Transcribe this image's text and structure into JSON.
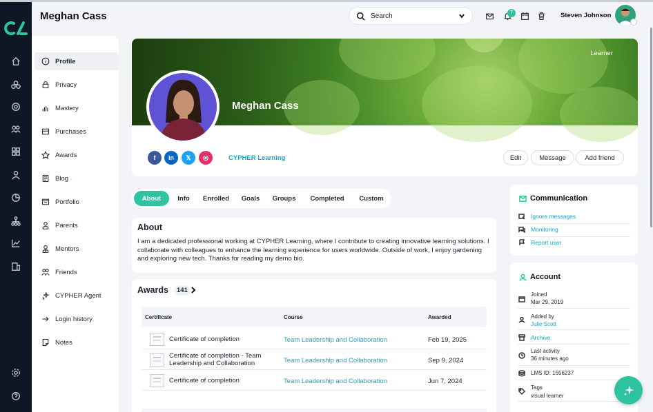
{
  "header": {
    "page_title": "Meghan Cass",
    "search_placeholder": "Search",
    "notification_count": "7",
    "user_name": "Steven Johnson"
  },
  "rail": {
    "icons": [
      "home-icon",
      "catalog-icon",
      "target-icon",
      "group-icon",
      "apps-icon",
      "person-icon",
      "chart-pie-icon",
      "org-chart-icon",
      "line-chart-icon",
      "reports-icon",
      "settings-icon",
      "help-icon"
    ]
  },
  "sidebar": {
    "items": [
      {
        "label": "Profile",
        "icon": "info-icon",
        "active": true
      },
      {
        "label": "Privacy",
        "icon": "lock-icon"
      },
      {
        "label": "Mastery",
        "icon": "bar-chart-icon"
      },
      {
        "label": "Purchases",
        "icon": "cart-icon"
      },
      {
        "label": "Awards",
        "icon": "star-icon"
      },
      {
        "label": "Blog",
        "icon": "blog-icon"
      },
      {
        "label": "Portfolio",
        "icon": "folder-icon"
      },
      {
        "label": "Parents",
        "icon": "parent-icon"
      },
      {
        "label": "Mentors",
        "icon": "mentor-icon"
      },
      {
        "label": "Friends",
        "icon": "friends-icon"
      },
      {
        "label": "CYPHER Agent",
        "icon": "sparkle-icon"
      },
      {
        "label": "Login history",
        "icon": "login-icon"
      },
      {
        "label": "Notes",
        "icon": "note-icon"
      }
    ]
  },
  "profile": {
    "name": "Meghan Cass",
    "role": "Learner",
    "organization": "CYPHER Learning",
    "socials": [
      "f",
      "in",
      "𝕏",
      "◎"
    ],
    "buttons": {
      "edit": "Edit",
      "message": "Message",
      "add_friend": "Add friend"
    }
  },
  "tabs": [
    "About",
    "Info",
    "Enrolled",
    "Goals",
    "Groups",
    "Completed",
    "Custom"
  ],
  "about": {
    "title": "About",
    "text": "I am a dedicated professional working at CYPHER Learning, where I contribute to creating innovative learning solutions. I collaborate with colleagues to enhance the learning experience for users worldwide. Outside of work, I enjoy gardening and exploring new tech. Thanks for reading my demo bio."
  },
  "awards": {
    "title": "Awards",
    "count": "141",
    "columns": [
      "Certificate",
      "Course",
      "Awarded"
    ],
    "rows": [
      {
        "certificate": "Certificate of completion",
        "course": "Team Leadership and Collaboration",
        "awarded": "Feb 19, 2025"
      },
      {
        "certificate": "Certificate of completion - Team Leadership and Collaboration",
        "course": "Team Leadership and Collaboration",
        "awarded": "Sep 9, 2024"
      },
      {
        "certificate": "Certificate of completion",
        "course": "Team Leadership and Collaboration",
        "awarded": "Jun 7, 2024"
      }
    ]
  },
  "communication": {
    "title": "Communication",
    "links": [
      "Ignore messages",
      "Monitoring",
      "Report user"
    ]
  },
  "account": {
    "title": "Account",
    "joined_label": "Joined",
    "joined_value": "Mar 29, 2019",
    "added_by_label": "Added by",
    "added_by_value": "Julie Scott",
    "archive": "Archive",
    "last_activity_label": "Last activity",
    "last_activity_value": "36 minutes ago",
    "lms_id": "LMS ID: 1556237",
    "tags_label": "Tags",
    "tags_value": "visual learner"
  },
  "colors": {
    "accent": "#2ec4a0",
    "link": "#1aa3c9",
    "rail": "#0f1726"
  }
}
